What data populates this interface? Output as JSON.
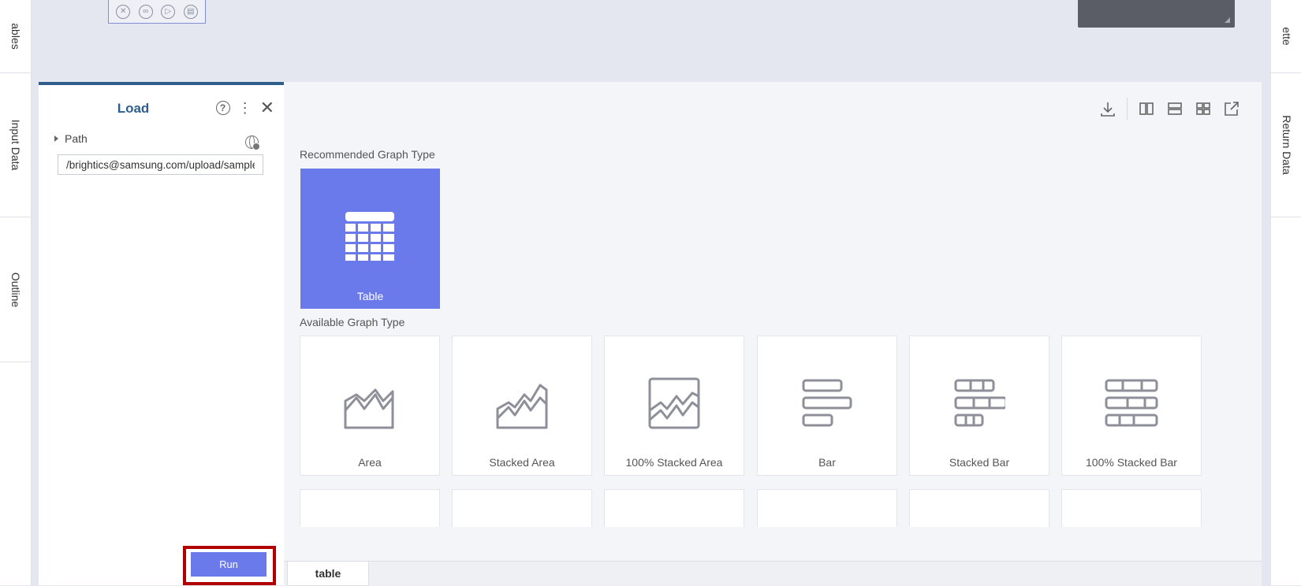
{
  "left_rail": {
    "tabs": [
      "ables",
      "Input Data",
      "Outline"
    ]
  },
  "right_rail": {
    "tabs": [
      "ette",
      "Return Data"
    ]
  },
  "node_toolbar": {
    "icons": [
      "close-circle-icon",
      "link-circle-icon",
      "play-circle-icon",
      "clipboard-circle-icon"
    ]
  },
  "panel": {
    "title": "Load",
    "path_label": "Path",
    "path_value": "/brightics@samsung.com/upload/sample",
    "run_label": "Run"
  },
  "chart_area": {
    "recommended_label": "Recommended Graph Type",
    "recommended_tile": "Table",
    "available_label": "Available Graph Type",
    "graph_types": [
      "Area",
      "Stacked Area",
      "100% Stacked Area",
      "Bar",
      "Stacked Bar",
      "100% Stacked Bar"
    ],
    "toolbar_icons": [
      "download-icon",
      "split-vertical-icon",
      "split-horizontal-icon",
      "grid-icon",
      "open-external-icon"
    ]
  },
  "bottom_tabs": {
    "active": "table"
  },
  "colors": {
    "accent": "#6b7aea",
    "title_blue": "#2f5e8c",
    "highlight_red": "#b00000"
  }
}
